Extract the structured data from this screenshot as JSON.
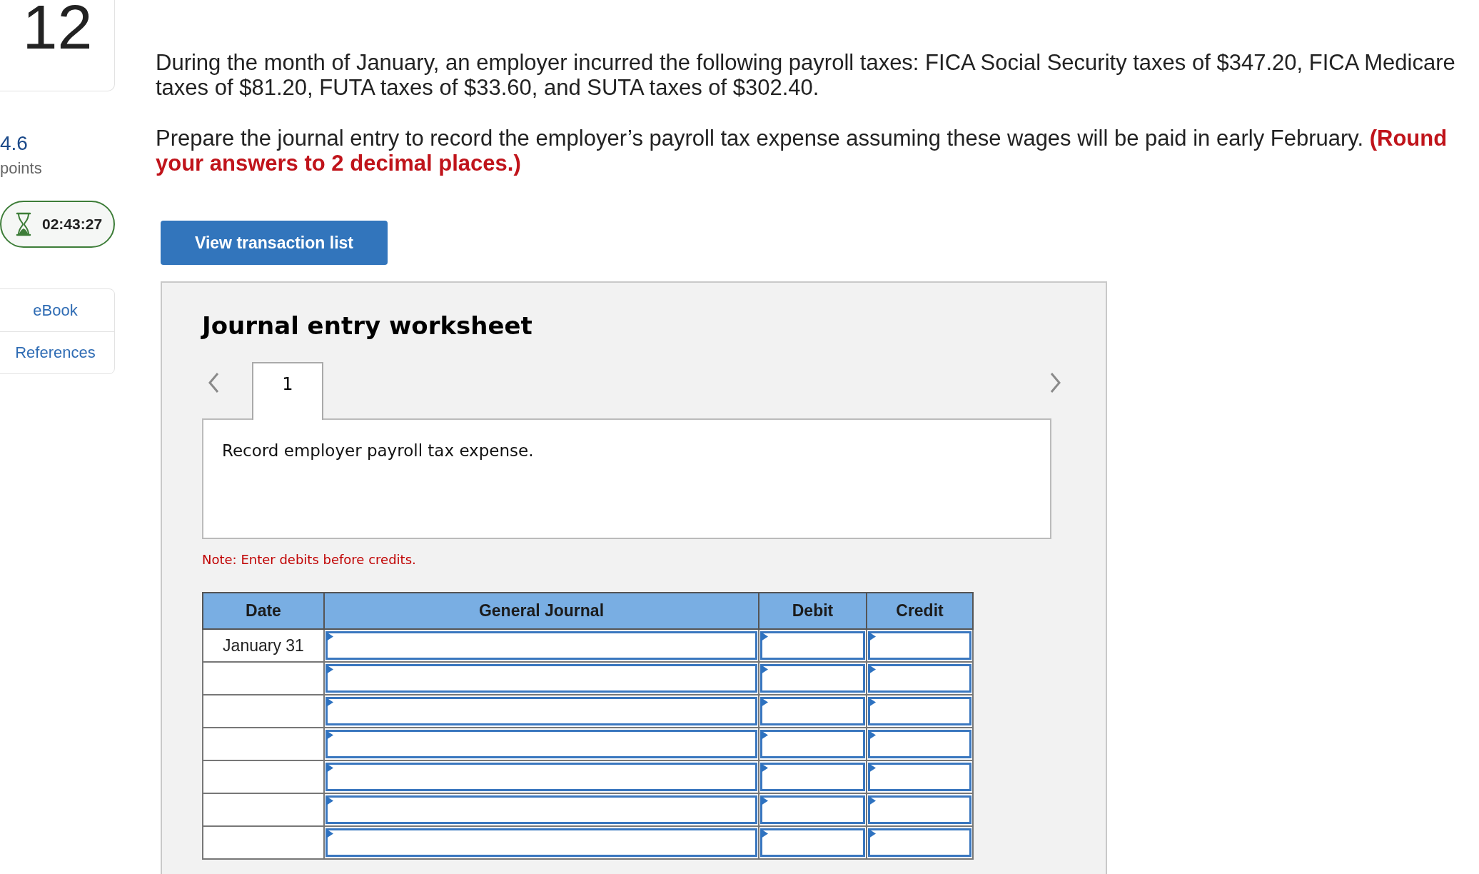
{
  "sidebar": {
    "question_number": "12",
    "points": {
      "value": "4.6",
      "label": "points"
    },
    "timer": "02:43:27",
    "links": [
      "eBook",
      "References"
    ]
  },
  "question": {
    "paragraphs": [
      "During the month of January, an employer incurred the following payroll taxes: FICA Social Security taxes of $347.20, FICA Medicare taxes of $81.20, FUTA taxes of $33.60, and SUTA taxes of $302.40.",
      "Prepare the journal entry to record the employer’s payroll tax expense assuming these wages will be paid in early February. **(Round your answers to 2 decimal places.)**"
    ]
  },
  "transaction_button": {
    "label": "View transaction list"
  },
  "worksheet": {
    "title": "Journal entry worksheet",
    "tabs": [
      {
        "label": "1",
        "selected": true
      }
    ],
    "description": "Record employer payroll tax expense.",
    "note": "Note: Enter debits before credits.",
    "table": {
      "columns": [
        "Date",
        "General Journal",
        "Debit",
        "Credit"
      ],
      "rows": [
        {
          "date": "January 31"
        },
        {},
        {},
        {},
        {},
        {},
        {}
      ]
    }
  }
}
